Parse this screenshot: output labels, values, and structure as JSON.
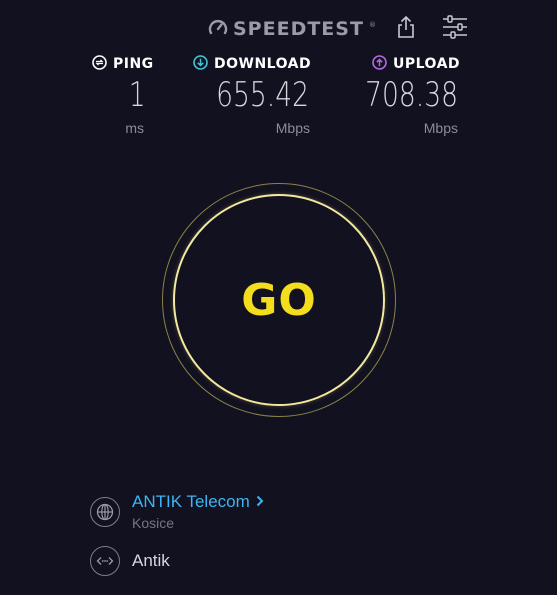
{
  "header": {
    "brand": "SPEEDTEST",
    "brand_mark": "®",
    "share_icon": "share-icon",
    "settings_icon": "settings-sliders-icon"
  },
  "metrics": {
    "ping": {
      "label": "PING",
      "value": "1",
      "unit": "ms",
      "icon": "ping-icon",
      "icon_color": "#ffffff"
    },
    "download": {
      "label": "DOWNLOAD",
      "value": "655.42",
      "unit": "Mbps",
      "icon": "download-arrow-icon",
      "icon_color": "#42c6d6"
    },
    "upload": {
      "label": "UPLOAD",
      "value": "708.38",
      "unit": "Mbps",
      "icon": "upload-arrow-icon",
      "icon_color": "#b56be6"
    }
  },
  "go_button": {
    "label": "GO",
    "text_color": "#f4dd1d",
    "ring_color": "#f2e9a0"
  },
  "isp": {
    "name": "ANTIK Telecom",
    "location": "Kosice",
    "icon": "globe-icon",
    "link_color": "#3fb4f2"
  },
  "server": {
    "name": "Antik",
    "icon": "server-connection-icon"
  },
  "colors": {
    "background": "#12111f",
    "muted_text": "#8b8c99"
  }
}
